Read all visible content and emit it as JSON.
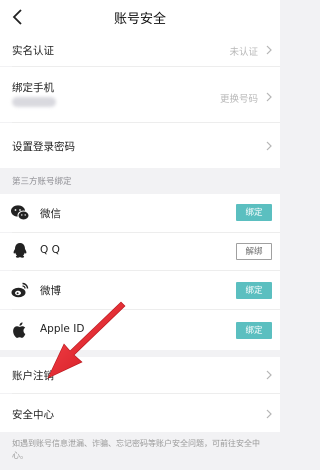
{
  "header": {
    "title": "账号安全",
    "back_icon": "back-chevron-icon"
  },
  "rows": {
    "realname": {
      "label": "实名认证",
      "value": "未认证"
    },
    "phone": {
      "label": "绑定手机",
      "value": "更换号码"
    },
    "password": {
      "label": "设置登录密码"
    },
    "account_cancel": {
      "label": "账户注销"
    },
    "security_center": {
      "label": "安全中心"
    }
  },
  "third_party": {
    "heading": "第三方账号绑定",
    "items": [
      {
        "label": "微信",
        "icon": "wechat-icon",
        "action": "绑定",
        "state": "unbound"
      },
      {
        "label": "Q Q",
        "icon": "qq-icon",
        "action": "解绑",
        "state": "bound"
      },
      {
        "label": "微博",
        "icon": "weibo-icon",
        "action": "绑定",
        "state": "unbound"
      },
      {
        "label": "Apple ID",
        "icon": "apple-icon",
        "action": "绑定",
        "state": "unbound"
      }
    ]
  },
  "footer": {
    "note": "如遇到账号信息泄漏、诈骗、忘记密码等账户安全问题，可前往安全中心。"
  },
  "colors": {
    "accent": "#5bbfc0",
    "annotation_arrow": "#e0242b",
    "background": "#f2f2f4"
  }
}
